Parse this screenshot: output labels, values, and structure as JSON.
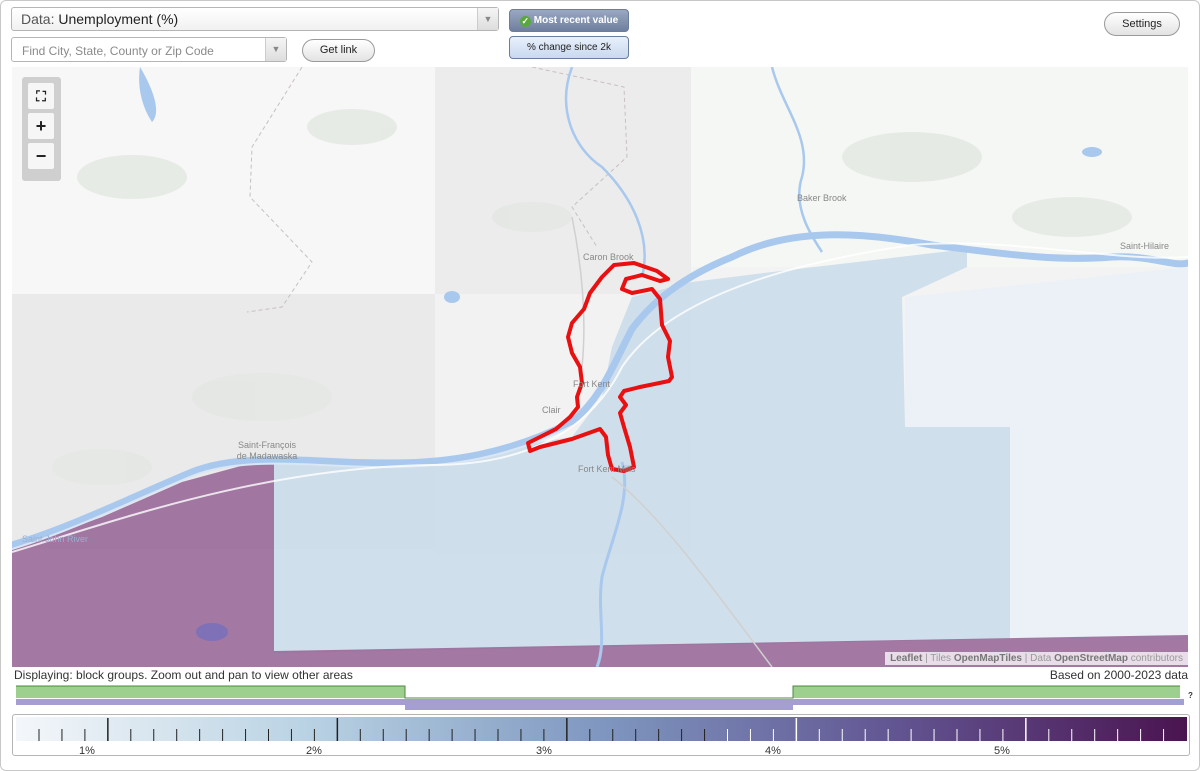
{
  "data_select": {
    "prefix": "Data:",
    "value": "Unemployment (%)"
  },
  "search": {
    "placeholder": "Find City, State, County or Zip Code"
  },
  "buttons": {
    "get_link": "Get link",
    "settings": "Settings"
  },
  "toggles": {
    "most_recent": "Most recent value",
    "change_since": "% change since 2k"
  },
  "map": {
    "place_labels": [
      "Baker Brook",
      "Saint-Hilaire",
      "Caron Brook",
      "Fort Kent",
      "Clair",
      "Fort Kent Mills",
      "Saint-François de Madawaska",
      "Saint John River"
    ],
    "attribution": {
      "leaflet": "Leaflet",
      "tiles_prefix": "Tiles",
      "tiles": "OpenMapTiles",
      "data_prefix": "Data",
      "data": "OpenStreetMap",
      "contributors": "contributors"
    },
    "colors": {
      "selected_outline": "#e81010",
      "low_fill": "#c9dbea",
      "high_fill": "#8e5a8e",
      "water": "#a9c8ee"
    }
  },
  "status": {
    "displaying": "Displaying: block groups. Zoom out and pan to view other areas",
    "based_on": "Based on 2000-2023 data"
  },
  "legend": {
    "tick_labels": [
      "1%",
      "2%",
      "3%",
      "4%",
      "5%"
    ],
    "gradient_start": "#f4f7fa",
    "gradient_end": "#4a1450",
    "help": "?"
  }
}
